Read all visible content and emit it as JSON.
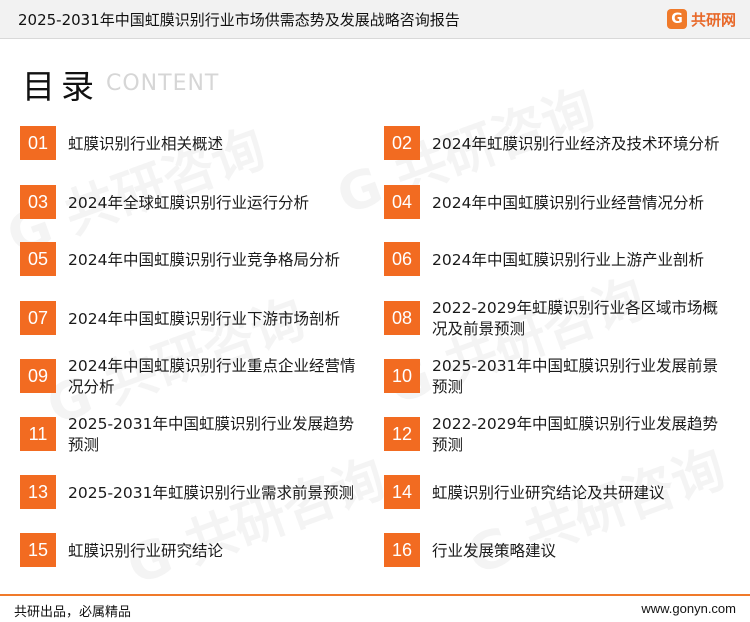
{
  "header": {
    "title": "2025-2031年中国虹膜识别行业市场供需态势及发展战略咨询报告",
    "brand_icon": "G",
    "brand_name": "共研网"
  },
  "toc": {
    "title": "目录",
    "subtitle": "CONTENT"
  },
  "items": [
    {
      "num": "01",
      "text": "虹膜识别行业相关概述"
    },
    {
      "num": "02",
      "text": "2024年虹膜识别行业经济及技术环境分析"
    },
    {
      "num": "03",
      "text": "2024年全球虹膜识别行业运行分析"
    },
    {
      "num": "04",
      "text": "2024年中国虹膜识别行业经营情况分析"
    },
    {
      "num": "05",
      "text": "2024年中国虹膜识别行业竞争格局分析"
    },
    {
      "num": "06",
      "text": "2024年中国虹膜识别行业上游产业剖析"
    },
    {
      "num": "07",
      "text": "2024年中国虹膜识别行业下游市场剖析"
    },
    {
      "num": "08",
      "text": "2022-2029年虹膜识别行业各区域市场概况及前景预测"
    },
    {
      "num": "09",
      "text": "2024年中国虹膜识别行业重点企业经营情况分析"
    },
    {
      "num": "10",
      "text": "2025-2031年中国虹膜识别行业发展前景预测"
    },
    {
      "num": "11",
      "text": "2025-2031年中国虹膜识别行业发展趋势预测"
    },
    {
      "num": "12",
      "text": "2022-2029年中国虹膜识别行业发展趋势预测"
    },
    {
      "num": "13",
      "text": "2025-2031年虹膜识别行业需求前景预测"
    },
    {
      "num": "14",
      "text": "虹膜识别行业研究结论及共研建议"
    },
    {
      "num": "15",
      "text": "虹膜识别行业研究结论"
    },
    {
      "num": "16",
      "text": "行业发展策略建议"
    }
  ],
  "footer": {
    "slogan": "共研出品，必属精品",
    "url": "www.gonyn.com"
  },
  "colors": {
    "accent": "#f26b21",
    "header_bg": "#f2f2f2"
  }
}
